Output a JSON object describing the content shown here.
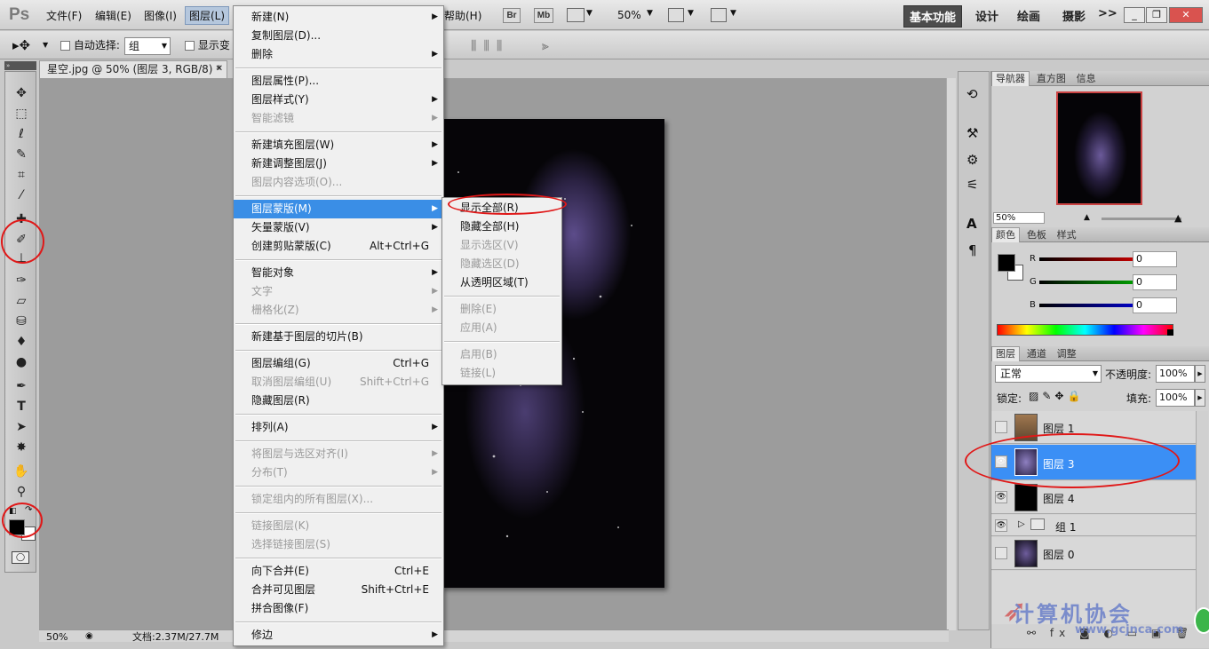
{
  "app": {
    "logo": "Ps"
  },
  "menubar": {
    "items": [
      "文件(F)",
      "编辑(E)",
      "图像(I)",
      "图层(L)",
      "帮助(H)"
    ],
    "tool_buttons": [
      "Br",
      "Mb"
    ],
    "zoom": "50%",
    "workspaces": [
      "基本功能",
      "设计",
      "绘画",
      "摄影"
    ],
    "more": ">>"
  },
  "options": {
    "auto_select_label": "自动选择:",
    "auto_select_value": "组",
    "show_transform_label": "显示变"
  },
  "document": {
    "tab_title": "星空.jpg @ 50% (图层 3, RGB/8) *",
    "zoom_status": "50%",
    "doc_size": "文档:2.37M/27.7M"
  },
  "layer_menu": {
    "items": [
      {
        "label": "新建(N)",
        "sub": true
      },
      {
        "label": "复制图层(D)..."
      },
      {
        "label": "删除",
        "sub": true
      },
      {
        "sep": true
      },
      {
        "label": "图层属性(P)..."
      },
      {
        "label": "图层样式(Y)",
        "sub": true
      },
      {
        "label": "智能滤镜",
        "sub": true,
        "dis": true
      },
      {
        "sep": true
      },
      {
        "label": "新建填充图层(W)",
        "sub": true
      },
      {
        "label": "新建调整图层(J)",
        "sub": true
      },
      {
        "label": "图层内容选项(O)...",
        "dis": true
      },
      {
        "sep": true
      },
      {
        "label": "图层蒙版(M)",
        "sub": true,
        "hi": true
      },
      {
        "label": "矢量蒙版(V)",
        "sub": true
      },
      {
        "label": "创建剪贴蒙版(C)",
        "sc": "Alt+Ctrl+G"
      },
      {
        "sep": true
      },
      {
        "label": "智能对象",
        "sub": true
      },
      {
        "label": "文字",
        "sub": true,
        "dis": true
      },
      {
        "label": "栅格化(Z)",
        "sub": true,
        "dis": true
      },
      {
        "sep": true
      },
      {
        "label": "新建基于图层的切片(B)"
      },
      {
        "sep": true
      },
      {
        "label": "图层编组(G)",
        "sc": "Ctrl+G"
      },
      {
        "label": "取消图层编组(U)",
        "sc": "Shift+Ctrl+G",
        "dis": true
      },
      {
        "label": "隐藏图层(R)"
      },
      {
        "sep": true
      },
      {
        "label": "排列(A)",
        "sub": true
      },
      {
        "sep": true
      },
      {
        "label": "将图层与选区对齐(I)",
        "sub": true,
        "dis": true
      },
      {
        "label": "分布(T)",
        "sub": true,
        "dis": true
      },
      {
        "sep": true
      },
      {
        "label": "锁定组内的所有图层(X)...",
        "dis": true
      },
      {
        "sep": true
      },
      {
        "label": "链接图层(K)",
        "dis": true
      },
      {
        "label": "选择链接图层(S)",
        "dis": true
      },
      {
        "sep": true
      },
      {
        "label": "向下合并(E)",
        "sc": "Ctrl+E"
      },
      {
        "label": "合并可见图层",
        "sc": "Shift+Ctrl+E"
      },
      {
        "label": "拼合图像(F)"
      },
      {
        "sep": true
      },
      {
        "label": "修边",
        "sub": true
      }
    ]
  },
  "mask_submenu": {
    "items": [
      {
        "label": "显示全部(R)"
      },
      {
        "label": "隐藏全部(H)"
      },
      {
        "label": "显示选区(V)",
        "dis": true
      },
      {
        "label": "隐藏选区(D)",
        "dis": true
      },
      {
        "label": "从透明区域(T)"
      },
      {
        "sep": true
      },
      {
        "label": "删除(E)",
        "dis": true
      },
      {
        "label": "应用(A)",
        "dis": true
      },
      {
        "sep": true
      },
      {
        "label": "启用(B)",
        "dis": true
      },
      {
        "label": "链接(L)",
        "dis": true
      }
    ]
  },
  "navigator": {
    "tabs": [
      "导航器",
      "直方图",
      "信息"
    ],
    "zoom": "50%"
  },
  "color_panel": {
    "tabs": [
      "颜色",
      "色板",
      "样式"
    ],
    "r": "0",
    "g": "0",
    "b": "0",
    "r_label": "R",
    "g_label": "G",
    "b_label": "B"
  },
  "layers_panel": {
    "tabs": [
      "图层",
      "通道",
      "调整"
    ],
    "blend_mode": "正常",
    "opacity_label": "不透明度:",
    "opacity": "100%",
    "lock_label": "锁定:",
    "fill_label": "填充:",
    "fill": "100%",
    "layers": [
      {
        "name": "图层 1",
        "visible": false,
        "selected": false
      },
      {
        "name": "图层 3",
        "visible": true,
        "selected": true
      },
      {
        "name": "图层 4",
        "visible": true,
        "selected": false
      },
      {
        "name": "组 1",
        "visible": true,
        "selected": false
      },
      {
        "name": "图层 0",
        "visible": false,
        "selected": false
      }
    ]
  },
  "watermark": {
    "text": "计算机协会",
    "url": "www.gcjnca.com"
  }
}
